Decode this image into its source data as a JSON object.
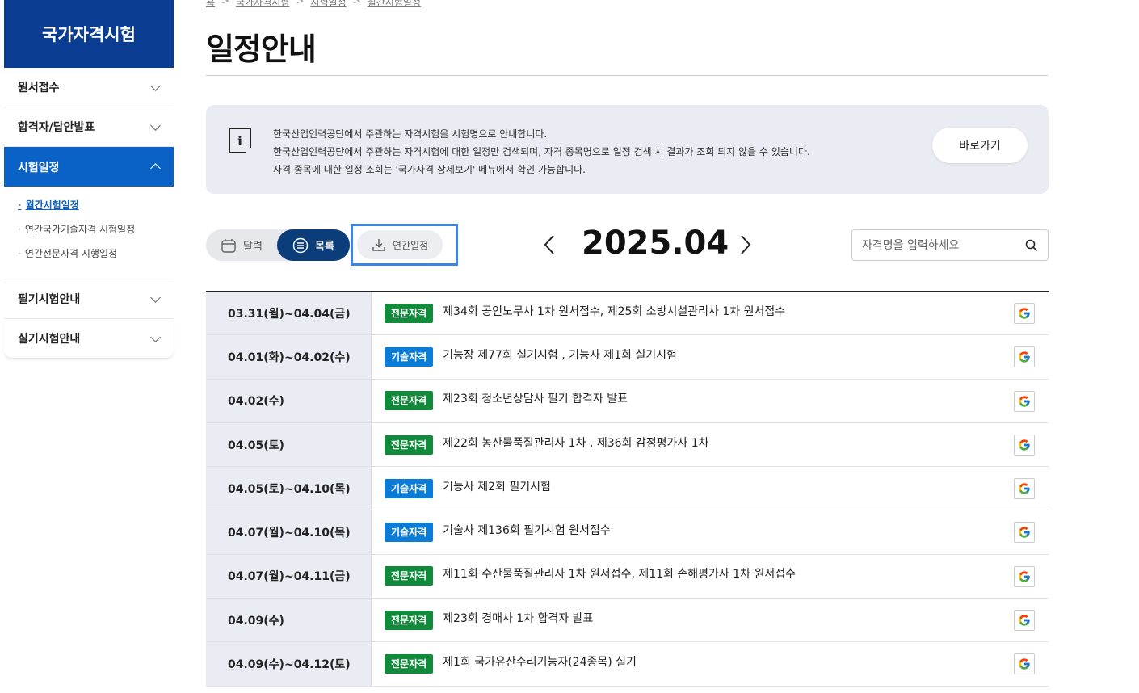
{
  "sidebar": {
    "title": "국가자격시험",
    "items": [
      {
        "label": "원서접수"
      },
      {
        "label": "합격자/답안발표"
      },
      {
        "label": "시험일정"
      },
      {
        "label": "필기시험안내"
      },
      {
        "label": "실기시험안내"
      }
    ],
    "sub_items": [
      {
        "label": "월간시험일정"
      },
      {
        "label": "연간국가기술자격 시험일정"
      },
      {
        "label": "연간전문자격 시행일정"
      }
    ]
  },
  "breadcrumb": [
    "홈",
    "국가자격시험",
    "시험일정",
    "월간시험일정"
  ],
  "page": {
    "title": "일정안내"
  },
  "info": {
    "lines": [
      "한국산업인력공단에서 주관하는 자격시험을 시험명으로 안내합니다.",
      "한국산업인력공단에서 주관하는 자격시험에 대한 일정만 검색되며, 자격 종목명으로 일정 검색 시 결과가 조회 되지 않을 수 있습니다.",
      "자격 종목에 대한 일정 조회는 '국가자격 상세보기' 메뉴에서 확인 가능합니다."
    ],
    "button": "바로가기"
  },
  "view": {
    "calendar": "달력",
    "list": "목록",
    "annual": "연간일정"
  },
  "month": {
    "label": "2025.04"
  },
  "search": {
    "placeholder": "자격명을 입력하세요"
  },
  "schedule": [
    {
      "date": "03.31(월)~04.04(금)",
      "type": "전문자격",
      "title": "제34회 공인노무사 1차 원서접수, 제25회 소방시설관리사 1차 원서접수"
    },
    {
      "date": "04.01(화)~04.02(수)",
      "type": "기술자격",
      "title": "기능장 제77회 실기시험 , 기능사 제1회 실기시험"
    },
    {
      "date": "04.02(수)",
      "type": "전문자격",
      "title": "제23회 청소년상담사 필기 합격자 발표"
    },
    {
      "date": "04.05(토)",
      "type": "전문자격",
      "title": "제22회 농산물품질관리사 1차 , 제36회 감정평가사 1차"
    },
    {
      "date": "04.05(토)~04.10(목)",
      "type": "기술자격",
      "title": "기능사 제2회 필기시험"
    },
    {
      "date": "04.07(월)~04.10(목)",
      "type": "기술자격",
      "title": "기술사 제136회 필기시험 원서접수"
    },
    {
      "date": "04.07(월)~04.11(금)",
      "type": "전문자격",
      "title": "제11회 수산물품질관리사 1차 원서접수, 제11회 손해평가사 1차 원서접수"
    },
    {
      "date": "04.09(수)",
      "type": "전문자격",
      "title": "제23회 경매사 1차 합격자 발표"
    },
    {
      "date": "04.09(수)~04.12(토)",
      "type": "전문자격",
      "title": "제1회 국가유산수리기능자(24종목) 실기"
    }
  ],
  "colors": {
    "navy": "#0a3d91",
    "active_blue": "#0a62c7",
    "pro_badge": "#118a3b",
    "tech_badge": "#0a7bd6",
    "highlight": "#3d84e6"
  }
}
